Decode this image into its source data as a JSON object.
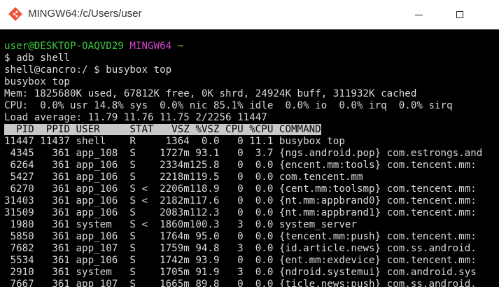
{
  "window": {
    "title": "MINGW64:/c/Users/user",
    "icon": "git-bash-icon",
    "controls": [
      "minimize",
      "maximize"
    ]
  },
  "prompt": {
    "user_host": "user@DESKTOP-OAQVD29",
    "shell": "MINGW64",
    "path": "~"
  },
  "lines": {
    "l1": "$ adb shell",
    "l2": "shell@cancro:/ $ busybox top",
    "l3": "busybox top",
    "l4": "Mem: 1825680K used, 67812K free, 0K shrd, 24924K buff, 311932K cached",
    "l5": "CPU:  0.0% usr 14.8% sys  0.0% nic 85.1% idle  0.0% io  0.0% irq  0.0% sirq",
    "l6": "Load average: 11.79 11.76 11.75 2/2256 11447"
  },
  "table_header": "  PID  PPID USER     STAT   VSZ %VSZ CPU %CPU COMMAND",
  "rows": [
    "11447 11437 shell    R     1364  0.0   0 11.1 busybox top",
    " 4345   361 app_108  S    1727m 93.1   0  3.7 {ngs.android.pop} com.estrongs.and",
    " 6264   361 app_106  S    2334m125.8   0  0.0 {encent.mm:tools} com.tencent.mm:",
    " 5427   361 app_106  S    2218m119.5   0  0.0 com.tencent.mm",
    " 6270   361 app_106  S <  2206m118.9   0  0.0 {cent.mm:toolsmp} com.tencent.mm:",
    "31403   361 app_106  S <  2182m117.6   0  0.0 {nt.mm:appbrand0} com.tencent.mm:",
    "31509   361 app_106  S    2083m112.3   0  0.0 {nt.mm:appbrand1} com.tencent.mm:",
    " 1980   361 system   S <  1860m100.3   3  0.0 system_server",
    " 5850   361 app_106  S    1764m 95.0   0  0.0 {tencent.mm:push} com.tencent.mm:",
    " 7682   361 app_107  S    1759m 94.8   3  0.0 {id.article.news} com.ss.android.",
    " 5534   361 app_106  S    1742m 93.9   0  0.0 {ent.mm:exdevice} com.tencent.mm:",
    " 2910   361 system   S    1705m 91.9   3  0.0 {ndroid.systemui} com.android.sys",
    " 7667   361 app_107  S    1665m 89.8   0  0.0 {ticle.news:push} com.ss.android."
  ],
  "colors": {
    "terminal_bg": "#000000",
    "prompt_user": "#3ec93e",
    "prompt_shell": "#c846c8",
    "prompt_path": "#c8c83e",
    "header_bg": "#c8c8c8"
  }
}
